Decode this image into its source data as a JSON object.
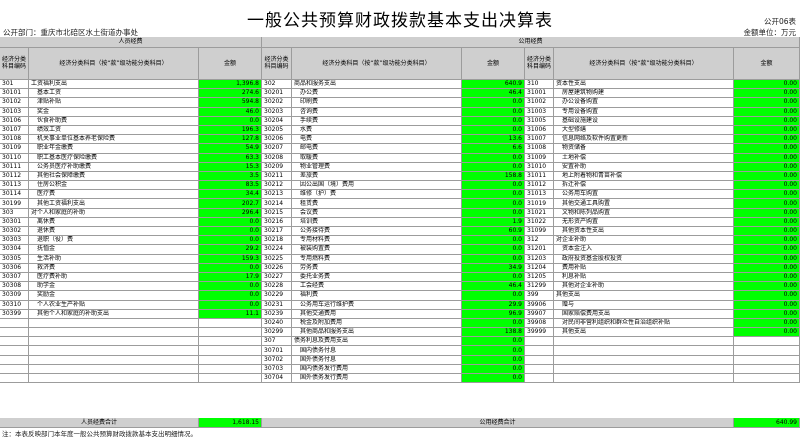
{
  "title": "一般公共预算财政拨款基本支出决算表",
  "form_code": "公开06表",
  "dept": "公开部门：重庆市北碚区水土街道办事处",
  "unit": "金额单位：万元",
  "headers": {
    "personnel": "人员经费",
    "public": "公用经费",
    "code": "经济分类科目编码",
    "name": "经济分类科目（按“款”级功能分类科目）",
    "amount": "金额"
  },
  "col1": [
    {
      "code": "301",
      "name": "工资福利支出",
      "amount": "1,396.8"
    },
    {
      "code": "30101",
      "name": "基本工资",
      "amount": "274.6"
    },
    {
      "code": "30102",
      "name": "津贴补贴",
      "amount": "594.8"
    },
    {
      "code": "30103",
      "name": "奖金",
      "amount": "46.0"
    },
    {
      "code": "30106",
      "name": "伙食补助费",
      "amount": "0.0"
    },
    {
      "code": "30107",
      "name": "绩效工资",
      "amount": "196.3"
    },
    {
      "code": "30108",
      "name": "机关事业单位基本养老保险费",
      "amount": "127.8"
    },
    {
      "code": "30109",
      "name": "职业年金缴费",
      "amount": "54.9"
    },
    {
      "code": "30110",
      "name": "职工基本医疗保险缴费",
      "amount": "63.3"
    },
    {
      "code": "30111",
      "name": "公务员医疗补助缴费",
      "amount": "15.3"
    },
    {
      "code": "30112",
      "name": "其他社会保障缴费",
      "amount": "3.5"
    },
    {
      "code": "30113",
      "name": "住房公积金",
      "amount": "83.5"
    },
    {
      "code": "30114",
      "name": "医疗费",
      "amount": "34.4"
    },
    {
      "code": "30199",
      "name": "其他工资福利支出",
      "amount": "202.7"
    },
    {
      "code": "303",
      "name": "对个人和家庭的补助",
      "amount": "296.4"
    },
    {
      "code": "30301",
      "name": "离休费",
      "amount": "0.0"
    },
    {
      "code": "30302",
      "name": "退休费",
      "amount": "0.0"
    },
    {
      "code": "30303",
      "name": "退职（役）费",
      "amount": "0.0"
    },
    {
      "code": "30304",
      "name": "抚恤金",
      "amount": "29.2"
    },
    {
      "code": "30305",
      "name": "生活补助",
      "amount": "159.3"
    },
    {
      "code": "30306",
      "name": "救济费",
      "amount": "0.0"
    },
    {
      "code": "30307",
      "name": "医疗费补助",
      "amount": "17.9"
    },
    {
      "code": "30308",
      "name": "助学金",
      "amount": "0.0"
    },
    {
      "code": "30309",
      "name": "奖励金",
      "amount": "0.0"
    },
    {
      "code": "30310",
      "name": "个人农业生产补贴",
      "amount": "0.0"
    },
    {
      "code": "30399",
      "name": "其他个人和家庭的补助支出",
      "amount": "11.1"
    },
    {
      "code": "",
      "name": "",
      "amount": ""
    },
    {
      "code": "",
      "name": "",
      "amount": ""
    },
    {
      "code": "",
      "name": "",
      "amount": ""
    },
    {
      "code": "",
      "name": "",
      "amount": ""
    },
    {
      "code": "",
      "name": "",
      "amount": ""
    }
  ],
  "col2": [
    {
      "code": "302",
      "name": "商品和服务支出",
      "amount": "640.9"
    },
    {
      "code": "30201",
      "name": "办公费",
      "amount": "46.4"
    },
    {
      "code": "30202",
      "name": "印刷费",
      "amount": "0.0"
    },
    {
      "code": "30203",
      "name": "咨询费",
      "amount": "0.0"
    },
    {
      "code": "30204",
      "name": "手续费",
      "amount": "0.0"
    },
    {
      "code": "30205",
      "name": "水费",
      "amount": "0.0"
    },
    {
      "code": "30206",
      "name": "电费",
      "amount": "13.6"
    },
    {
      "code": "30207",
      "name": "邮电费",
      "amount": "6.6"
    },
    {
      "code": "30208",
      "name": "取暖费",
      "amount": "0.0"
    },
    {
      "code": "30209",
      "name": "物业管理费",
      "amount": "0.0"
    },
    {
      "code": "30211",
      "name": "差旅费",
      "amount": "158.8"
    },
    {
      "code": "30212",
      "name": "因公出国（境）费用",
      "amount": "0.0"
    },
    {
      "code": "30213",
      "name": "维修（护）费",
      "amount": "0.0"
    },
    {
      "code": "30214",
      "name": "租赁费",
      "amount": "0.0"
    },
    {
      "code": "30215",
      "name": "会议费",
      "amount": "0.0"
    },
    {
      "code": "30216",
      "name": "培训费",
      "amount": "1.9"
    },
    {
      "code": "30217",
      "name": "公务接待费",
      "amount": "60.9"
    },
    {
      "code": "30218",
      "name": "专用材料费",
      "amount": "0.0"
    },
    {
      "code": "30224",
      "name": "被装购置费",
      "amount": "0.0"
    },
    {
      "code": "30225",
      "name": "专用燃料费",
      "amount": "0.0"
    },
    {
      "code": "30226",
      "name": "劳务费",
      "amount": "34.9"
    },
    {
      "code": "30227",
      "name": "委托业务费",
      "amount": "0.0"
    },
    {
      "code": "30228",
      "name": "工会经费",
      "amount": "46.4"
    },
    {
      "code": "30229",
      "name": "福利费",
      "amount": "0.0"
    },
    {
      "code": "30231",
      "name": "公务用车运行维护费",
      "amount": "29.9"
    },
    {
      "code": "30239",
      "name": "其他交通费用",
      "amount": "96.9"
    },
    {
      "code": "30240",
      "name": "税金及附加费用",
      "amount": "0.0"
    },
    {
      "code": "30299",
      "name": "其他商品和服务支出",
      "amount": "138.8"
    },
    {
      "code": "307",
      "name": "债务利息及费用支出",
      "amount": "0.0"
    },
    {
      "code": "30701",
      "name": "国内债务付息",
      "amount": "0.0"
    },
    {
      "code": "30702",
      "name": "国外债务付息",
      "amount": "0.0"
    },
    {
      "code": "30703",
      "name": "国内债务发行费用",
      "amount": "0.0"
    },
    {
      "code": "30704",
      "name": "国外债务发行费用",
      "amount": "0.0"
    }
  ],
  "col3": [
    {
      "code": "310",
      "name": "资本性支出",
      "amount": "0.00"
    },
    {
      "code": "31001",
      "name": "房屋建筑物购建",
      "amount": "0.00"
    },
    {
      "code": "31002",
      "name": "办公设备购置",
      "amount": "0.00"
    },
    {
      "code": "31003",
      "name": "专用设备购置",
      "amount": "0.00"
    },
    {
      "code": "31005",
      "name": "基础设施建设",
      "amount": "0.00"
    },
    {
      "code": "31006",
      "name": "大型修缮",
      "amount": "0.00"
    },
    {
      "code": "31007",
      "name": "信息网络及软件购置更新",
      "amount": "0.00"
    },
    {
      "code": "31008",
      "name": "物资储备",
      "amount": "0.00"
    },
    {
      "code": "31009",
      "name": "土地补偿",
      "amount": "0.00"
    },
    {
      "code": "31010",
      "name": "安置补助",
      "amount": "0.00"
    },
    {
      "code": "31011",
      "name": "地上附着物和青苗补偿",
      "amount": "0.00"
    },
    {
      "code": "31012",
      "name": "拆迁补偿",
      "amount": "0.00"
    },
    {
      "code": "31013",
      "name": "公务用车购置",
      "amount": "0.00"
    },
    {
      "code": "31019",
      "name": "其他交通工具购置",
      "amount": "0.00"
    },
    {
      "code": "31021",
      "name": "文物和陈列品购置",
      "amount": "0.00"
    },
    {
      "code": "31022",
      "name": "无形资产购置",
      "amount": "0.00"
    },
    {
      "code": "31099",
      "name": "其他资本性支出",
      "amount": "0.00"
    },
    {
      "code": "312",
      "name": "对企业补助",
      "amount": "0.00"
    },
    {
      "code": "31201",
      "name": "资本金注入",
      "amount": "0.00"
    },
    {
      "code": "31203",
      "name": "政府投资基金股权投资",
      "amount": "0.00"
    },
    {
      "code": "31204",
      "name": "费用补贴",
      "amount": "0.00"
    },
    {
      "code": "31205",
      "name": "利息补贴",
      "amount": "0.00"
    },
    {
      "code": "31299",
      "name": "其他对企业补助",
      "amount": "0.00"
    },
    {
      "code": "399",
      "name": "其他支出",
      "amount": "0.00"
    },
    {
      "code": "39906",
      "name": "赠与",
      "amount": "0.00"
    },
    {
      "code": "39907",
      "name": "国家赔偿费用支出",
      "amount": "0.00"
    },
    {
      "code": "39908",
      "name": "对民间非营利组织和群众性自治组织补贴",
      "amount": "0.00"
    },
    {
      "code": "39999",
      "name": "其他支出",
      "amount": "0.00"
    },
    {
      "code": "",
      "name": "",
      "amount": ""
    },
    {
      "code": "",
      "name": "",
      "amount": ""
    },
    {
      "code": "",
      "name": "",
      "amount": ""
    },
    {
      "code": "",
      "name": "",
      "amount": ""
    },
    {
      "code": "",
      "name": "",
      "amount": ""
    }
  ],
  "totals": {
    "personnel_label": "人员经费合计",
    "personnel_amount": "1,618.15",
    "public_label": "公用经费合计",
    "public_amount": "640.99"
  },
  "note": "注：本表反映部门本年度一般公共预算财政拨款基本支出明细情况。",
  "colors": {
    "highlight": "#00ff00",
    "header": "#cfcfcf"
  }
}
